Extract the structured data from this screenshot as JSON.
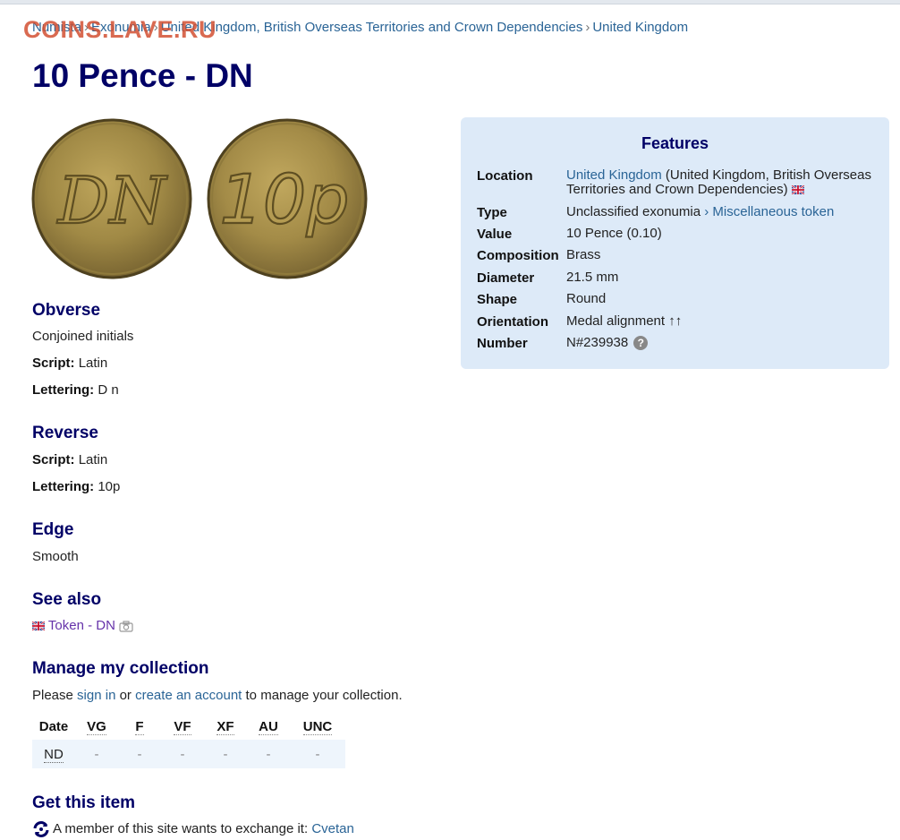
{
  "breadcrumb": {
    "items": [
      "Numista",
      "Exonumia",
      "United Kingdom, British Overseas Territories and Crown Dependencies",
      "United Kingdom"
    ],
    "separator": "›"
  },
  "watermark": "COINS.LAVE.RU",
  "title": "10 Pence - DN",
  "coin_images": {
    "obverse_text": "DN",
    "reverse_text": "10p"
  },
  "features": {
    "heading": "Features",
    "rows": [
      {
        "label": "Location",
        "link": "United Kingdom",
        "text": "(United Kingdom, British Overseas Territories and Crown Dependencies)"
      },
      {
        "label": "Type",
        "text": "Unclassified exonumia",
        "sep": "›",
        "link": "Miscellaneous token"
      },
      {
        "label": "Value",
        "text": "10 Pence (0.10)"
      },
      {
        "label": "Composition",
        "text": "Brass"
      },
      {
        "label": "Diameter",
        "text": "21.5 mm"
      },
      {
        "label": "Shape",
        "text": "Round"
      },
      {
        "label": "Orientation",
        "text": "Medal alignment ↑↑"
      },
      {
        "label": "Number",
        "text": "N#239938",
        "help": "?"
      }
    ]
  },
  "obverse": {
    "heading": "Obverse",
    "description": "Conjoined initials",
    "script_label": "Script:",
    "script": "Latin",
    "lettering_label": "Lettering:",
    "lettering": "D n"
  },
  "reverse": {
    "heading": "Reverse",
    "script_label": "Script:",
    "script": "Latin",
    "lettering_label": "Lettering:",
    "lettering": "10p"
  },
  "edge": {
    "heading": "Edge",
    "text": "Smooth"
  },
  "see_also": {
    "heading": "See also",
    "link": "Token - DN"
  },
  "collection": {
    "heading": "Manage my collection",
    "text_before": "Please",
    "sign_in": "sign in",
    "or": "or",
    "create_account": "create an account",
    "text_after": "to manage your collection.",
    "columns": [
      "Date",
      "VG",
      "F",
      "VF",
      "XF",
      "AU",
      "UNC"
    ],
    "rows": [
      {
        "date": "ND",
        "values": [
          "-",
          "-",
          "-",
          "-",
          "-",
          "-"
        ]
      }
    ]
  },
  "get_item": {
    "heading": "Get this item",
    "text": "A member of this site wants to exchange it:",
    "member": "Cvetan"
  },
  "colors": {
    "heading": "#000066",
    "link": "#2a6496",
    "features_bg": "#ddeaf8",
    "watermark": "#d25032"
  }
}
